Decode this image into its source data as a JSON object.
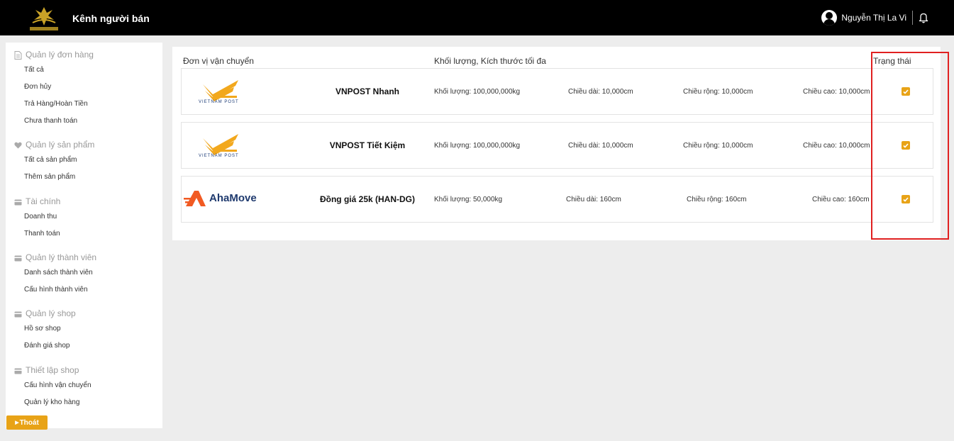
{
  "header": {
    "title": "Kênh người bán",
    "user_name": "Nguyễn Thị La Vi",
    "bg_color": "#000000"
  },
  "sidebar": {
    "sections": [
      {
        "title": "Quản lý đơn hàng",
        "icon": "document-icon",
        "items": [
          "Tất cả",
          "Đơn hủy",
          "Trả Hàng/Hoàn Tiền",
          "Chưa thanh toán"
        ]
      },
      {
        "title": "Quản lý sản phẩm",
        "icon": "heart-icon",
        "items": [
          "Tất cả sản phẩm",
          "Thêm sản phẩm"
        ]
      },
      {
        "title": "Tài chính",
        "icon": "card-icon",
        "items": [
          "Doanh thu",
          "Thanh toán"
        ]
      },
      {
        "title": "Quản lý thành viên",
        "icon": "card-icon",
        "items": [
          "Danh sách thành viên",
          "Cấu hình thành viên"
        ]
      },
      {
        "title": "Quản lý shop",
        "icon": "card-icon",
        "items": [
          "Hồ sơ shop",
          "Đánh giá shop"
        ]
      },
      {
        "title": "Thiết lập shop",
        "icon": "card-icon",
        "items": [
          "Cấu hình vận chuyển",
          "Quản lý kho hàng"
        ]
      }
    ],
    "logout_label": "Thoát",
    "accent_color": "#e8a317"
  },
  "table": {
    "headers": {
      "carrier": "Đơn vị vận chuyển",
      "limits": "Khối lượng, Kích thước tối đa",
      "status": "Trạng thái"
    },
    "rows": [
      {
        "logo": "VIETNAM POST",
        "service": "VNPOST Nhanh",
        "weight": "Khối lượng: 100,000,000kg",
        "length": "Chiều dài: 10,000cm",
        "width": "Chiều rộng: 10,000cm",
        "height": "Chiều cao: 10,000cm",
        "enabled": true
      },
      {
        "logo": "VIETNAM POST",
        "service": "VNPOST Tiết Kiệm",
        "weight": "Khối lượng: 100,000,000kg",
        "length": "Chiều dài: 10,000cm",
        "width": "Chiều rộng: 10,000cm",
        "height": "Chiều cao: 10,000cm",
        "enabled": true
      },
      {
        "logo": "AhaMove",
        "service": "Đồng giá 25k (HAN-DG)",
        "weight": "Khối lượng: 50,000kg",
        "length": "Chiều dài: 160cm",
        "width": "Chiều rộng: 160cm",
        "height": "Chiều cao: 160cm",
        "enabled": true
      }
    ]
  },
  "highlight_color": "#e02020"
}
